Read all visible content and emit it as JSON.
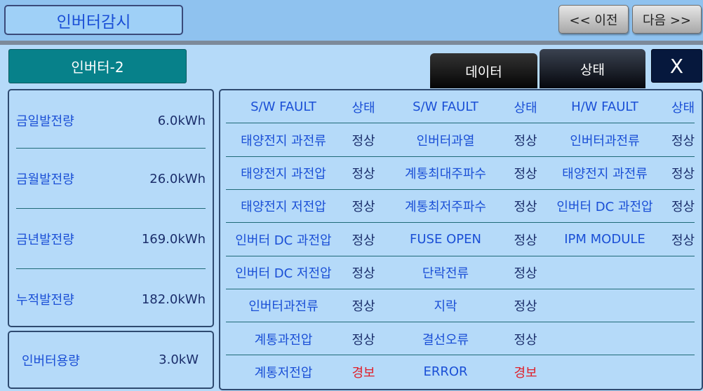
{
  "header": {
    "title": "인버터감시",
    "prev_label": "<< 이전",
    "next_label": "다음 >>"
  },
  "inverter": {
    "name": "인버터-2"
  },
  "tabs": {
    "data_label": "데이터",
    "status_label": "상태",
    "close_label": "X"
  },
  "energy": [
    {
      "label": "금일발전량",
      "value": "6.0kWh"
    },
    {
      "label": "금월발전량",
      "value": "26.0kWh"
    },
    {
      "label": "금년발전량",
      "value": "169.0kWh"
    },
    {
      "label": "누적발전량",
      "value": "182.0kWh"
    }
  ],
  "capacity": {
    "label": "인버터용량",
    "value": "3.0kW"
  },
  "faults": {
    "header": {
      "col1": "S/W FAULT",
      "stat1": "상태",
      "col2": "S/W FAULT",
      "stat2": "상태",
      "col3": "H/W FAULT",
      "stat3": "상태"
    },
    "rows": [
      {
        "n1": "태양전지 과전류",
        "s1": "정상",
        "n2": "인버터과열",
        "s2": "정상",
        "n3": "인버터과전류",
        "s3": "정상"
      },
      {
        "n1": "태양전지 과전압",
        "s1": "정상",
        "n2": "계통최대주파수",
        "s2": "정상",
        "n3": "태양전지 과전류",
        "s3": "정상"
      },
      {
        "n1": "태양전지 저전압",
        "s1": "정상",
        "n2": "계통최저주파수",
        "s2": "정상",
        "n3": "인버터 DC 과전압",
        "s3": "정상"
      },
      {
        "n1": "인버터 DC 과전압",
        "s1": "정상",
        "n2": "FUSE OPEN",
        "s2": "정상",
        "n3": "IPM MODULE",
        "s3": "정상"
      },
      {
        "n1": "인버터 DC 저전압",
        "s1": "정상",
        "n2": "단락전류",
        "s2": "정상",
        "n3": "",
        "s3": ""
      },
      {
        "n1": "인버터과전류",
        "s1": "정상",
        "n2": "지락",
        "s2": "정상",
        "n3": "",
        "s3": ""
      },
      {
        "n1": "계통과전압",
        "s1": "정상",
        "n2": "결선오류",
        "s2": "정상",
        "n3": "",
        "s3": ""
      },
      {
        "n1": "계통저전압",
        "s1": "경보",
        "n2": "ERROR",
        "s2": "경보",
        "n3": "",
        "s3": ""
      }
    ]
  },
  "colors": {
    "alarm": "#e0202a",
    "normal": "#1b2e6b",
    "label": "#1a4fd6",
    "name_badge": "#07818a"
  }
}
